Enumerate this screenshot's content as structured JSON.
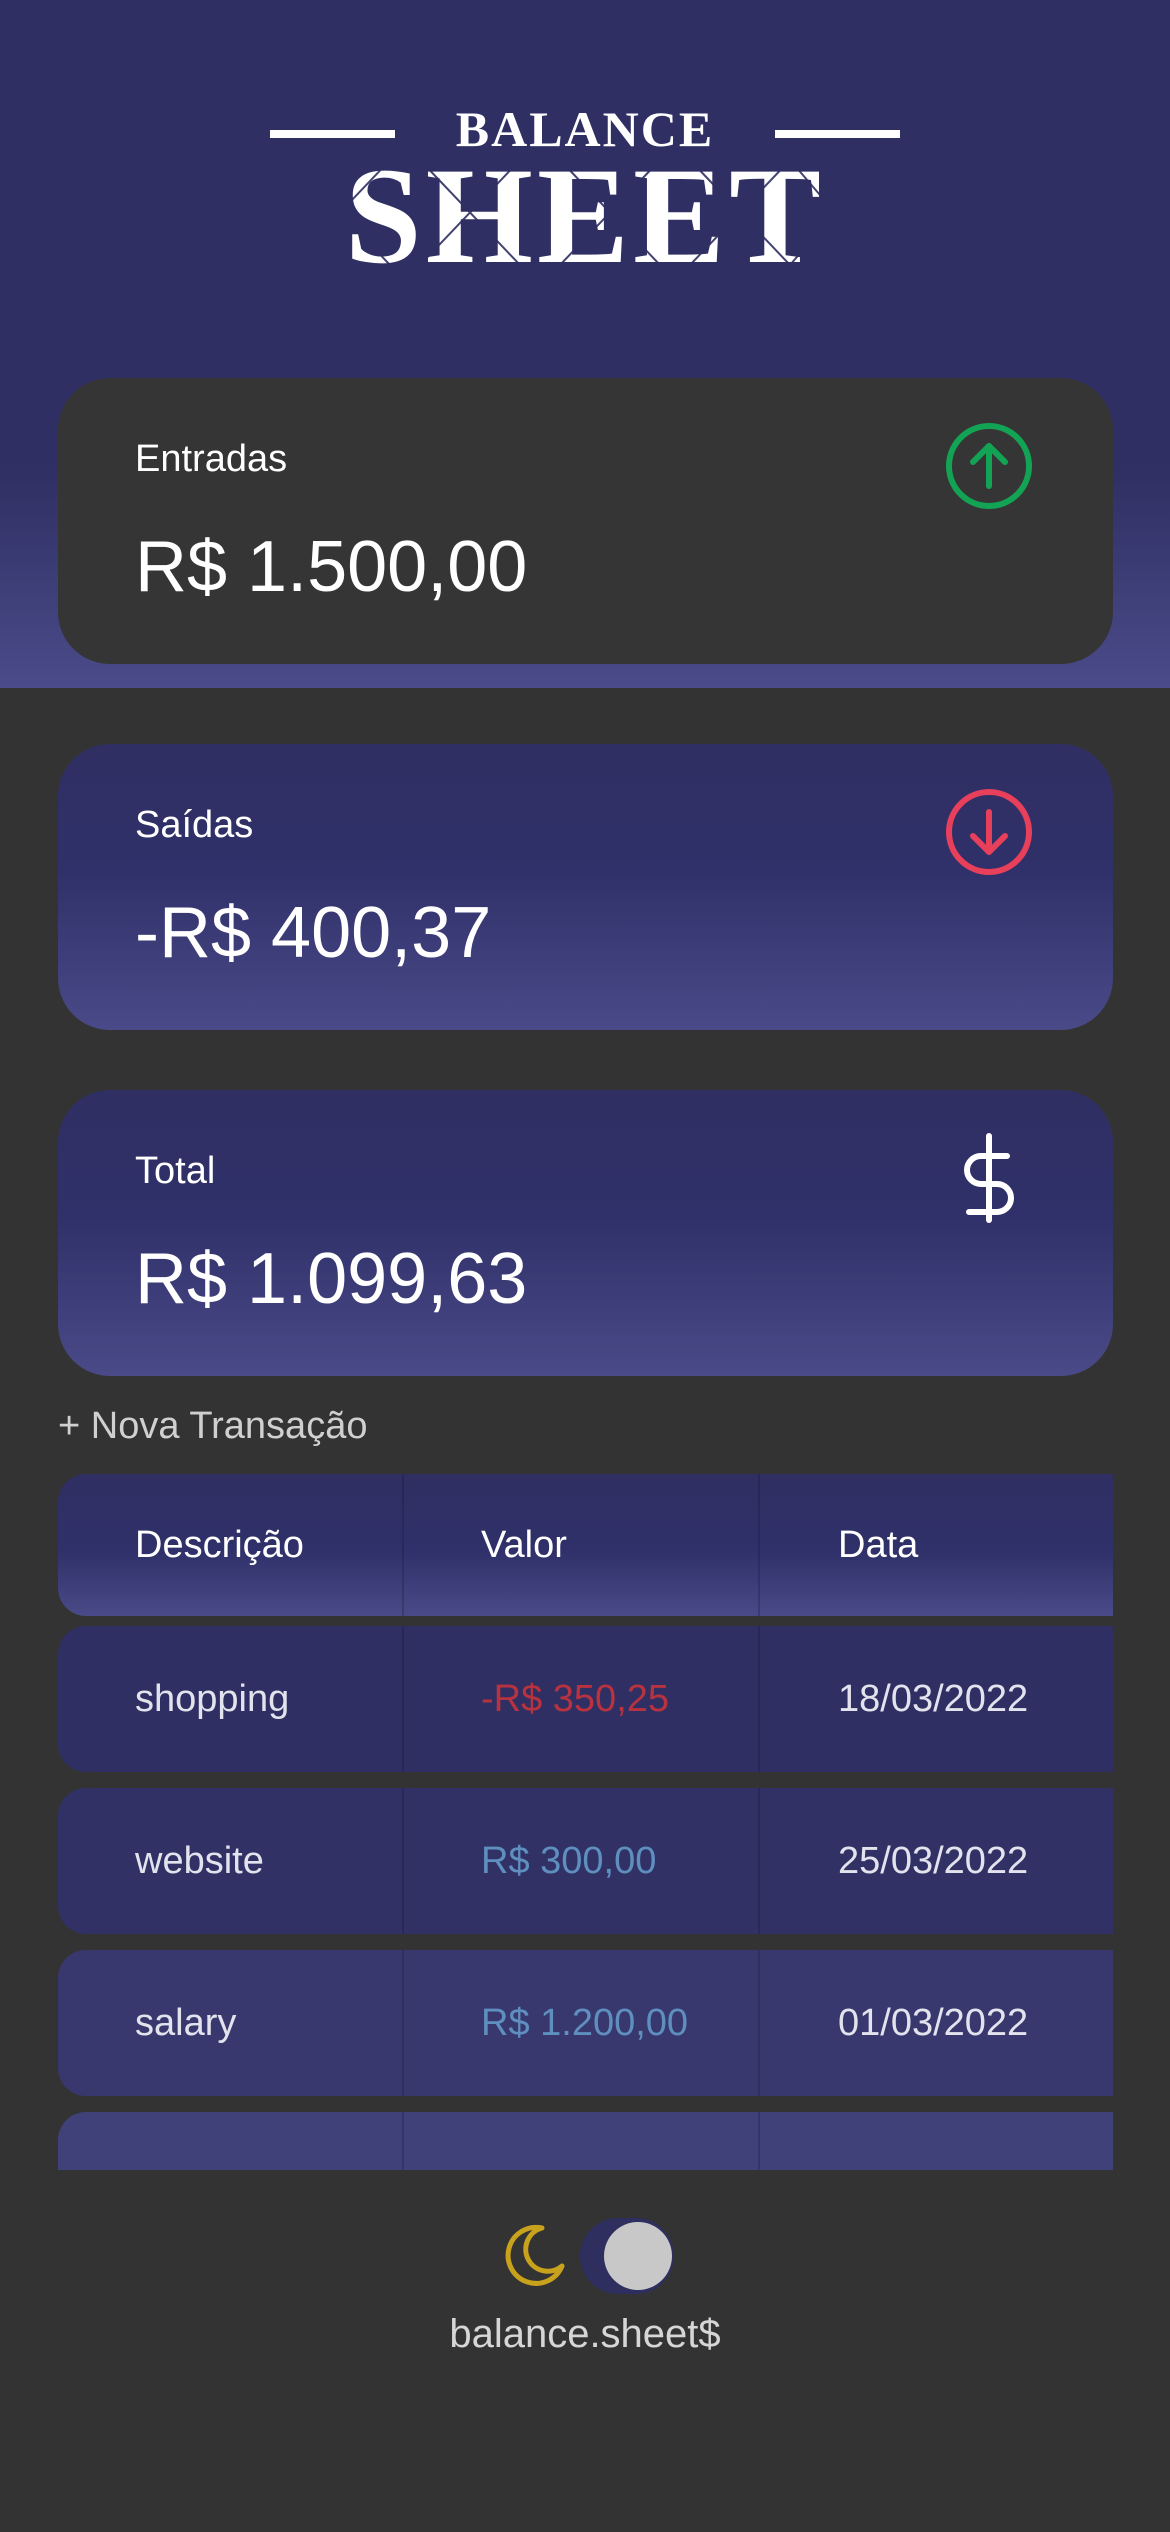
{
  "app": {
    "logo_top": "BALANCE",
    "logo_bottom": "SHEET"
  },
  "cards": {
    "income": {
      "label": "Entradas",
      "value": "R$ 1.500,00",
      "icon": "arrow-up-circle-icon",
      "icon_color": "#12a454"
    },
    "expense": {
      "label": "Saídas",
      "value": "-R$ 400,37",
      "icon": "arrow-down-circle-icon",
      "icon_color": "#e83f5b"
    },
    "total": {
      "label": "Total",
      "value": "R$ 1.099,63",
      "icon": "dollar-sign-icon",
      "icon_color": "#ffffff"
    }
  },
  "actions": {
    "new_transaction": "+ Nova Transação"
  },
  "table": {
    "headers": [
      "Descrição",
      "Valor",
      "Data"
    ],
    "rows": [
      {
        "description": "shopping",
        "amount": "-R$ 350,25",
        "date": "18/03/2022",
        "type": "expense"
      },
      {
        "description": "website",
        "amount": "R$ 300,00",
        "date": "25/03/2022",
        "type": "income"
      },
      {
        "description": "salary",
        "amount": "R$ 1.200,00",
        "date": "01/03/2022",
        "type": "income"
      }
    ]
  },
  "colors": {
    "income_amount": "#5f8fbf",
    "expense_amount": "#b8323f",
    "accent": "#2f2f63",
    "moon": "#c8a21c"
  },
  "footer": {
    "theme_toggle_icon": "moon-icon",
    "brand": "balance.sheet$"
  }
}
